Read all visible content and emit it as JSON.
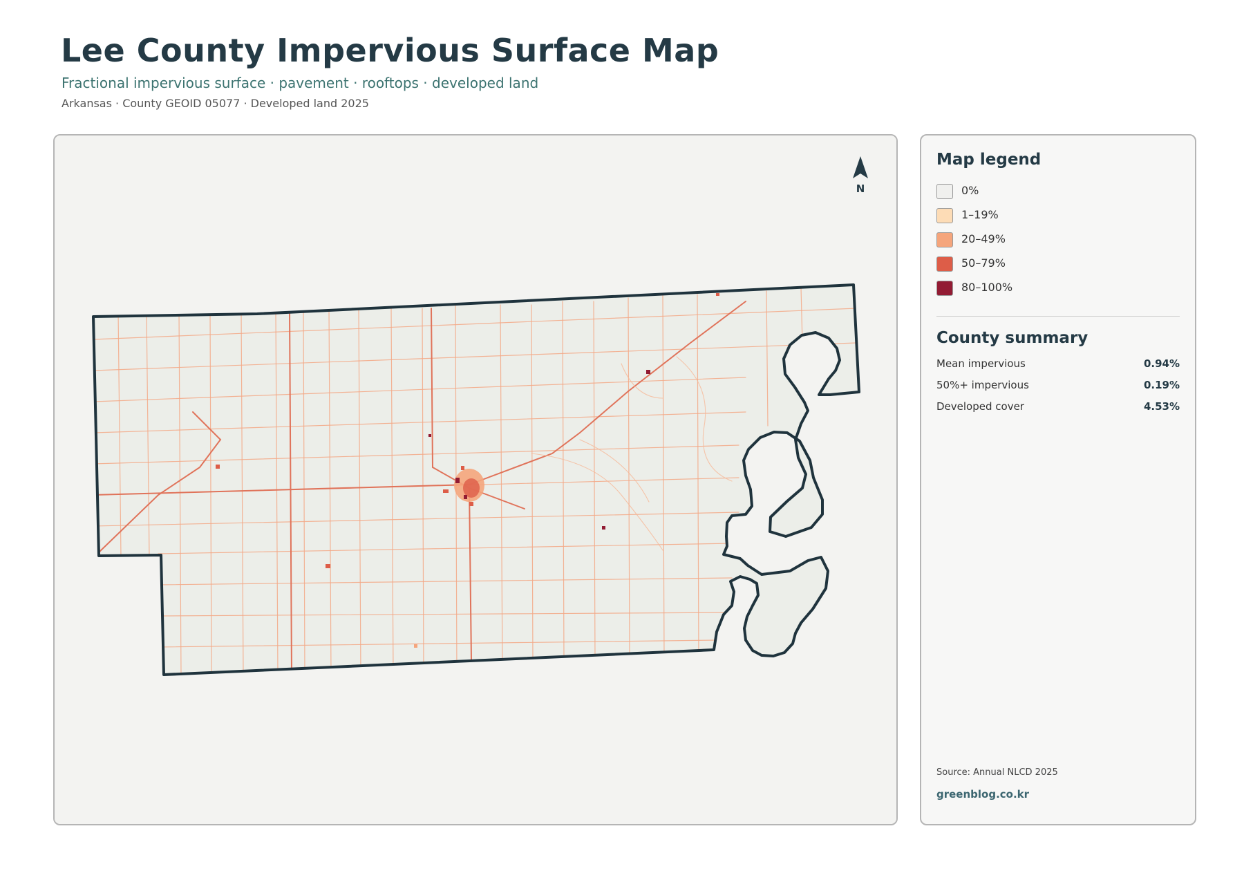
{
  "header": {
    "title": "Lee County Impervious Surface Map",
    "subtitle": "Fractional impervious surface · pavement · rooftops · developed land",
    "meta": "Arkansas · County GEOID 05077 · Developed land 2025"
  },
  "map": {
    "north_label": "N",
    "boundary_color": "#1f333d",
    "land_color": "#eceee9"
  },
  "legend": {
    "title": "Map legend",
    "items": [
      {
        "label": "0%",
        "color": "#f0f0ee"
      },
      {
        "label": "1–19%",
        "color": "#fddcb6"
      },
      {
        "label": "20–49%",
        "color": "#f5a57c"
      },
      {
        "label": "50–79%",
        "color": "#dd5d48"
      },
      {
        "label": "80–100%",
        "color": "#921b33"
      }
    ]
  },
  "summary": {
    "title": "County summary",
    "rows": [
      {
        "label": "Mean impervious",
        "value": "0.94%"
      },
      {
        "label": "50%+ impervious",
        "value": "0.19%"
      },
      {
        "label": "Developed cover",
        "value": "4.53%"
      }
    ]
  },
  "footer": {
    "source": "Source: Annual NLCD 2025",
    "brand": "greenblog.co.kr"
  }
}
